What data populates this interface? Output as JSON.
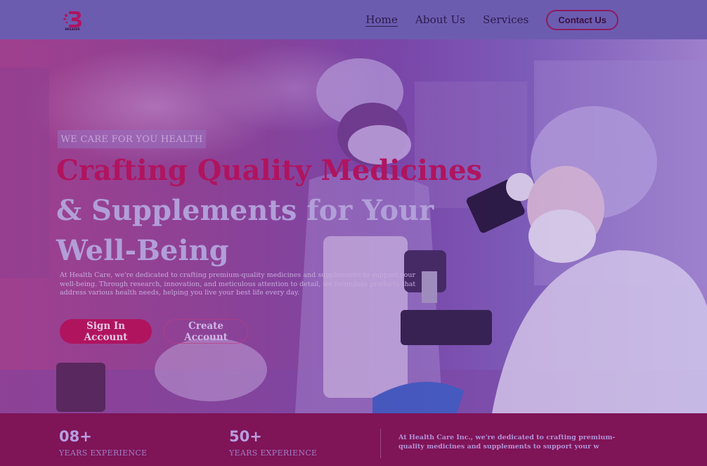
{
  "brand": {
    "logo_text": "BREADER"
  },
  "nav": {
    "links": [
      {
        "label": "Home",
        "active": true
      },
      {
        "label": "About Us",
        "active": false
      },
      {
        "label": "Services",
        "active": false
      }
    ],
    "contact_label": "Contact Us"
  },
  "hero": {
    "tagline": "WE CARE FOR YOU HEALTH",
    "headline_line1": "Crafting Quality Medicines",
    "headline_line2": "& Supplements for Your",
    "headline_line3": "Well-Being",
    "description": "At Health Care, we're dedicated to crafting premium-quality medicines and supplements to support your well-being. Through research, innovation, and meticulous attention to detail, we formulate products that address various health needs, helping you live your best life every day.",
    "signin_label": "Sign In Account",
    "create_label": "Create Account"
  },
  "stats": {
    "items": [
      {
        "number": "08+",
        "label": "YEARS EXPERIENCE"
      },
      {
        "number": "50+",
        "label": "YEARS EXPERIENCE"
      }
    ],
    "text": "At Health Care Inc., we're dedicated to crafting premium-quality medicines and supplements to support your w"
  },
  "colors": {
    "accent": "#b0145f",
    "nav_bg": "#6c5cb0",
    "stats_bg": "#7f1457"
  }
}
